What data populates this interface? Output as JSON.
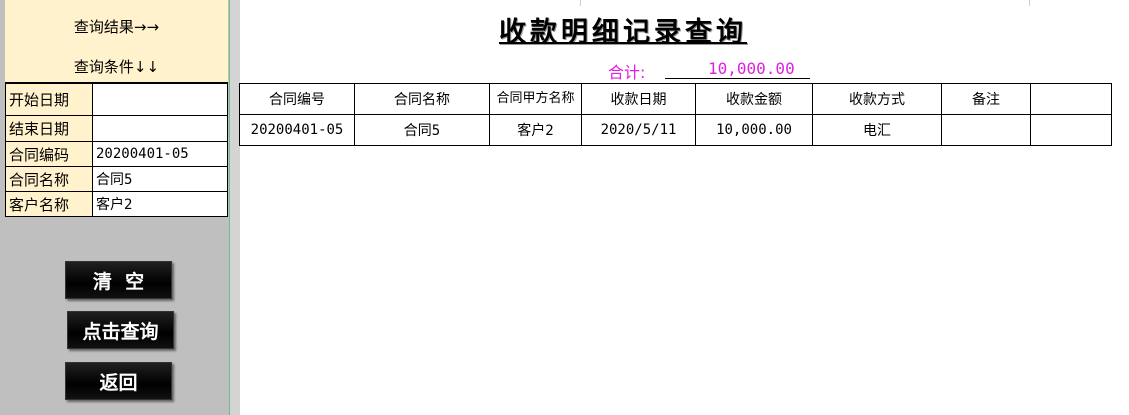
{
  "left": {
    "result_caption": "查询结果→→",
    "condition_caption": "查询条件↓↓",
    "fields": [
      {
        "label": "开始日期",
        "value": ""
      },
      {
        "label": "结束日期",
        "value": ""
      },
      {
        "label": "合同编码",
        "value": "20200401-05"
      },
      {
        "label": "合同名称",
        "value": "合同5"
      },
      {
        "label": "客户名称",
        "value": "客户2"
      }
    ],
    "buttons": {
      "clear": "清  空",
      "query": "点击查询",
      "back": "返回"
    }
  },
  "main": {
    "title": "收款明细记录查询",
    "total_label": "合计:",
    "total_value": "10,000.00",
    "columns": [
      "合同编号",
      "合同名称",
      "合同甲方名称",
      "收款日期",
      "收款金额",
      "收款方式",
      "备注",
      ""
    ],
    "rows": [
      [
        "20200401-05",
        "合同5",
        "客户2",
        "2020/5/11",
        "10,000.00",
        "电汇",
        "",
        ""
      ]
    ]
  }
}
